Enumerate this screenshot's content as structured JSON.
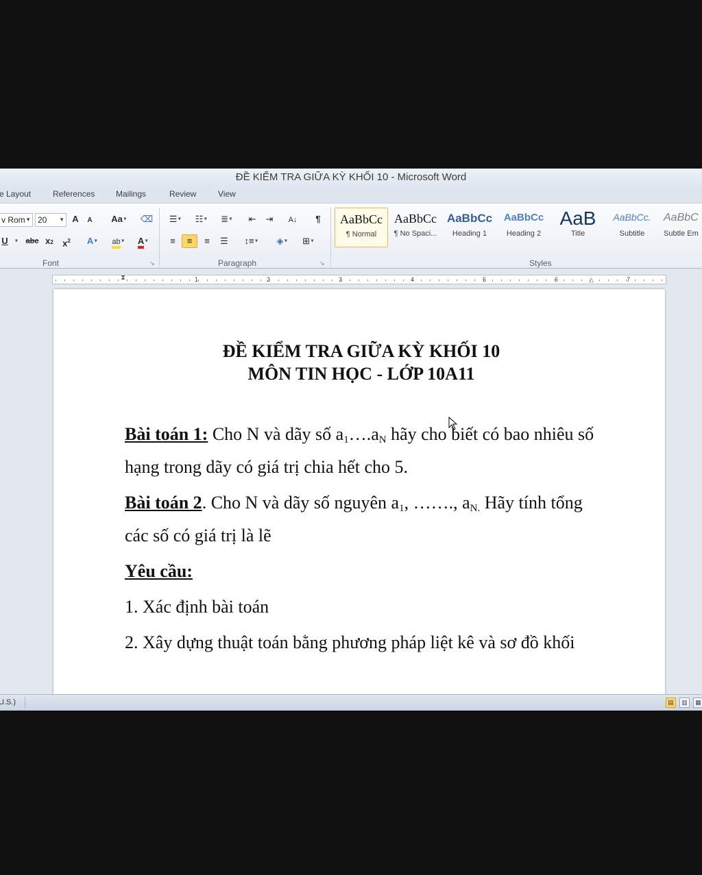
{
  "window": {
    "title": "ĐỀ KIỂM TRA GIỮA KỲ KHỐI 10  -  Microsoft Word"
  },
  "tabs": [
    "e Layout",
    "References",
    "Mailings",
    "Review",
    "View"
  ],
  "font": {
    "name": "v Rom",
    "size": "20",
    "group_label": "Font",
    "grow": "A",
    "shrink": "A",
    "case": "Aa",
    "underline": "U",
    "strike": "abc",
    "sub": "x",
    "sup": "x",
    "color_a": "A"
  },
  "paragraph": {
    "group_label": "Paragraph",
    "pilcrow": "¶"
  },
  "styles": {
    "group_label": "Styles",
    "items": [
      {
        "sample": "AaBbCc",
        "name": "¶ Normal"
      },
      {
        "sample": "AaBbCc",
        "name": "¶ No Spaci..."
      },
      {
        "sample": "AaBbCc",
        "name": "Heading 1"
      },
      {
        "sample": "AaBbCc",
        "name": "Heading 2"
      },
      {
        "sample": "AaB",
        "name": "Title"
      },
      {
        "sample": "AaBbCc.",
        "name": "Subtitle"
      },
      {
        "sample": "AaBbC",
        "name": "Subtle Em"
      }
    ]
  },
  "ruler": {
    "numbers": [
      "1",
      "2",
      "3",
      "4",
      "5",
      "6",
      "7"
    ]
  },
  "document": {
    "title1": "ĐỀ KIỂM TRA GIỮA KỲ KHỐI 10",
    "title2": "MÔN TIN HỌC - LỚP 10A11",
    "p1_label": "Bài toán 1:",
    "p1_text_a": " Cho N và dãy số a",
    "p1_sub1": "1",
    "p1_text_b": "….a",
    "p1_sub2": "N",
    "p1_text_c": " hãy cho biết có bao nhiêu số hạng trong dãy có giá trị chia hết cho 5.",
    "p2_label": "Bài toán 2",
    "p2_text_a": ". Cho N và dãy số nguyên a",
    "p2_sub1": "1",
    "p2_text_b": ", ……., a",
    "p2_sub2": "N.",
    "p2_text_c": " Hãy tính tổng các số có giá trị là lẽ",
    "req_label": "Yêu cầu:",
    "req1": "1. Xác định bài toán",
    "req2": "2. Xây dựng thuật toán bằng phương pháp liệt kê và sơ đồ khối"
  },
  "status": {
    "language": "U.S.)"
  }
}
